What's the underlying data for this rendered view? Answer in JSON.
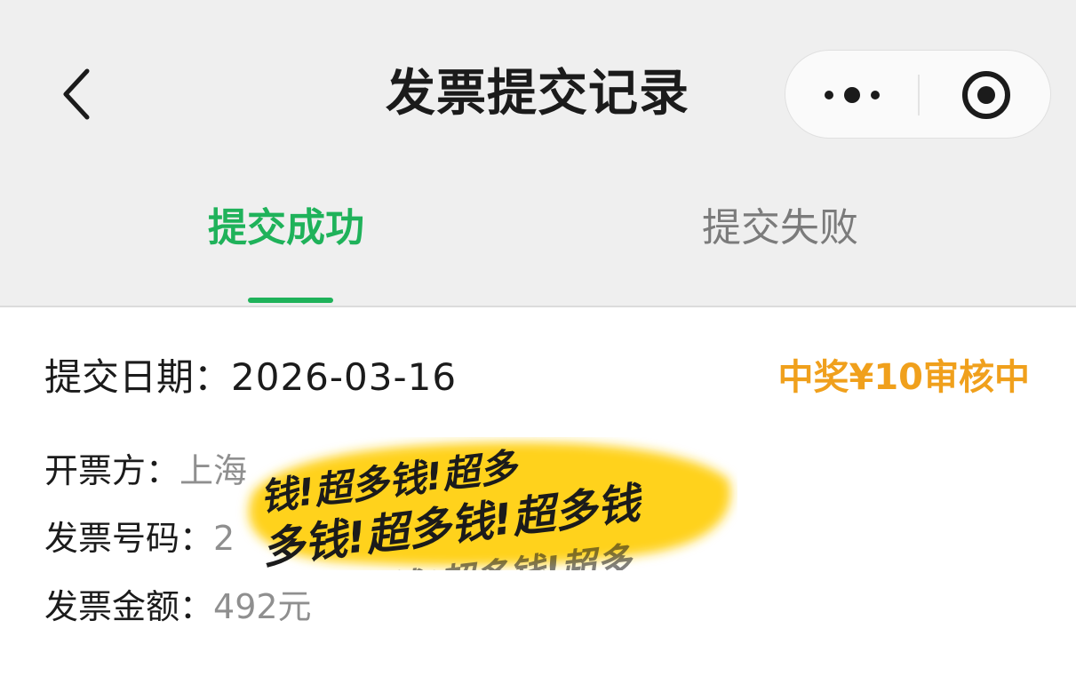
{
  "nav": {
    "title": "发票提交记录",
    "back_icon": "chevron-left-icon",
    "more_icon": "more-dots-icon",
    "close_icon": "record-close-icon"
  },
  "tabs": [
    {
      "label": "提交成功",
      "active": true
    },
    {
      "label": "提交失败",
      "active": false
    }
  ],
  "record": {
    "date_label": "提交日期：",
    "date_value": "2026-03-16",
    "status": "中奖¥10审核中",
    "issuer_label": "开票方：",
    "issuer_value": "上海",
    "number_label": "发票号码：",
    "number_value": "2",
    "amount_label": "发票金额：",
    "amount_value": "492元"
  },
  "sticker": {
    "lines": [
      "钱!超多钱!超多",
      "多钱!超多钱!超多钱",
      "钱!超多钱!超多"
    ],
    "color": "#ffd21a"
  },
  "colors": {
    "accent": "#1fb25a",
    "status": "#f0a01c"
  }
}
